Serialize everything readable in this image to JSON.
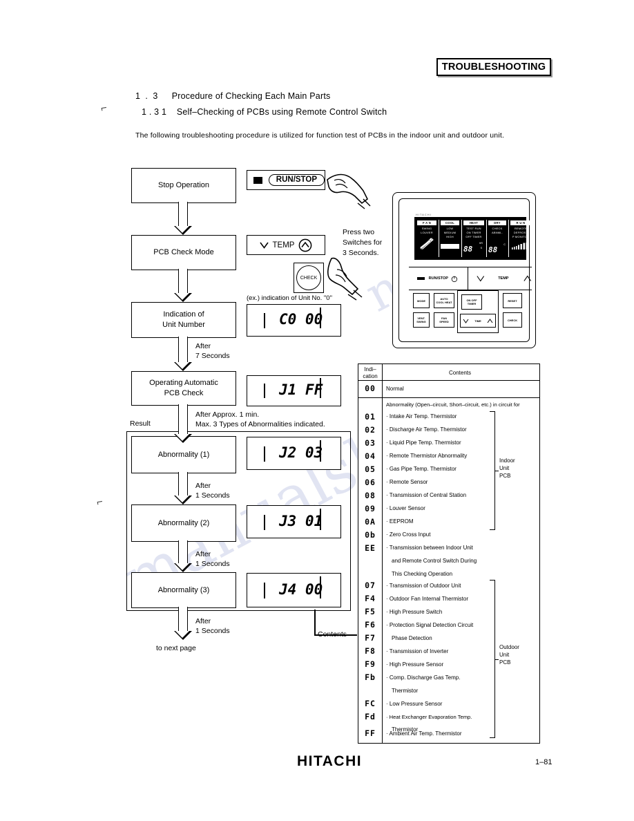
{
  "header": {
    "banner": "TROUBLESHOOTING",
    "section_number": "1 . 3",
    "section_title": "Procedure of Checking Each Main Parts",
    "subsection_number": "1 . 3  1",
    "subsection_title": "Self–Checking of PCBs using Remote Control Switch",
    "intro": "The following troubleshooting procedure is utilized for function test of PCBs in the indoor unit and outdoor unit."
  },
  "flow": {
    "steps": [
      {
        "label": "Stop Operation"
      },
      {
        "label": "PCB Check Mode"
      },
      {
        "label_line1": "Indication of",
        "label_line2": "Unit Number"
      },
      {
        "label_line1": "Operating Automatic",
        "label_line2": "PCB Check"
      },
      {
        "label": "Abnormality (1)"
      },
      {
        "label": "Abnormality (2)"
      },
      {
        "label": "Abnormality (3)"
      }
    ],
    "notes": {
      "after_7_seconds_l1": "After",
      "after_7_seconds_l2": "7 Seconds",
      "after_approx_l1": "After Approx. 1 min.",
      "after_approx_l2": "Max. 3 Types of Abnormalities indicated.",
      "result": "Result",
      "after_1_seconds_l1": "After",
      "after_1_seconds_l2": "1 Seconds",
      "to_next_page": "to next page",
      "contents_link": "Contents"
    }
  },
  "keys": {
    "run_stop": "RUN/STOP",
    "temp": "TEMP",
    "temp_down_icon": "chevron-down-icon",
    "temp_up_icon": "chevron-up-icon",
    "check": "CHECK",
    "press_note_l1": "Press two",
    "press_note_l2": "Switches for",
    "press_note_l3": "3 Seconds.",
    "hand_icon": "pointing-hand-icon"
  },
  "displays": {
    "example_caption": "(ex.) indication of Unit No. \"0\"",
    "unit_number": "C0 00",
    "auto_check": "J1 FF",
    "abnormality_1": "J2 03",
    "abnormality_2": "J3 01",
    "abnormality_3": "J4 00"
  },
  "remote": {
    "brand": "HITACHI",
    "lcd": {
      "cells": [
        {
          "tag": "F A N",
          "labels": [
            "SWING",
            "LOUVER"
          ],
          "icon": "louver-blades-icon"
        },
        {
          "tag": "COOL",
          "labels": [
            "LOW",
            "MEDIUM",
            "HIGH"
          ],
          "bar": "fan-speed-bar-icon"
        },
        {
          "tag": "HEAT",
          "labels": [
            "TEST RUN",
            "ON TIMER",
            "OFF TIMER"
          ],
          "value": "88",
          "unit_top": "HR",
          "unit_bottom": "S"
        },
        {
          "tag": "DRY",
          "labels": [
            "CHECK",
            "ABNML."
          ],
          "value": "88",
          "unit_top": "C"
        },
        {
          "tag": "R U N",
          "labels": [
            "REMOTE",
            "DEFROST",
            "P MONITOR"
          ],
          "bar": "signal-bars-icon"
        }
      ]
    },
    "control_row": {
      "run_stop": "RUN/STOP",
      "power_icon": "power-icon",
      "temp": "TEMP",
      "down_icon": "chevron-down-icon",
      "up_icon": "chevron-up-icon"
    },
    "buttons": [
      {
        "id": "mode",
        "label": "MODE"
      },
      {
        "id": "auto-louver",
        "label": "AUTO\nCOOL HEAT"
      },
      {
        "id": "timer",
        "label": "ON OFF\nTIMER"
      },
      {
        "id": "reset",
        "label": "RESET"
      },
      {
        "id": "vent-swing",
        "label": "VENT.\nSWING"
      },
      {
        "id": "fan-speed",
        "label": "FAN\nSPEED"
      },
      {
        "id": "time",
        "label": "TIME"
      },
      {
        "id": "check",
        "label": "CHECK"
      }
    ]
  },
  "table": {
    "header_indication_l1": "Indi–",
    "header_indication_l2": "cation",
    "header_contents": "Contents",
    "normal": {
      "code": "00",
      "text": "Normal"
    },
    "abnormality_heading": "Abnormality (Open–circuit, Short–circuit, etc.) in circuit for",
    "indoor_group_label_l1": "Indoor",
    "indoor_group_label_l2": "Unit",
    "indoor_group_label_l3": "PCB",
    "outdoor_group_label_l1": "Outdoor",
    "outdoor_group_label_l2": "Unit",
    "outdoor_group_label_l3": "PCB",
    "indoor_rows": [
      {
        "code": "01",
        "text": "· Intake Air Temp. Thermistor"
      },
      {
        "code": "02",
        "text": "· Discharge Air Temp. Thermistor"
      },
      {
        "code": "03",
        "text": "· Liquid Pipe Temp. Thermistor"
      },
      {
        "code": "04",
        "text": "· Remote Thermistor Abnormality"
      },
      {
        "code": "05",
        "text": "· Gas Pipe Temp. Thermistor"
      },
      {
        "code": "06",
        "text": "· Remote Sensor"
      },
      {
        "code": "08",
        "text": "· Transmission of Central Station"
      },
      {
        "code": "09",
        "text": "· Louver Sensor"
      },
      {
        "code": "0A",
        "text": "· EEPROM"
      }
    ],
    "extra_rows": [
      {
        "code": "0b",
        "text": "· Zero Cross Input"
      },
      {
        "code": "EE",
        "text": "· Transmission between Indoor Unit"
      },
      {
        "code": "",
        "text": "and Remote Control Switch During"
      },
      {
        "code": "",
        "text": "This Checking Operation"
      }
    ],
    "outdoor_rows": [
      {
        "code": "07",
        "text": "· Transmission of Outdoor Unit"
      },
      {
        "code": "F4",
        "text": "· Outdoor Fan Internal Thermistor"
      },
      {
        "code": "F5",
        "text": "· High Pressure Switch"
      },
      {
        "code": "F6",
        "text": "· Protection Signal Detection Circuit"
      },
      {
        "code": "F7",
        "text": "Phase Detection"
      },
      {
        "code": "F8",
        "text": "· Transmission of Inverter"
      },
      {
        "code": "F9",
        "text": "· High Pressure Sensor"
      },
      {
        "code": "Fb",
        "text": "· Comp. Discharge Gas Temp."
      },
      {
        "code": "",
        "text": "Thermistor"
      },
      {
        "code": "FC",
        "text": "· Low Pressure Sensor"
      },
      {
        "code": "Fd",
        "text": "· Heat Exchanger Evaporation Temp."
      },
      {
        "code": "",
        "text": "Thermistor"
      },
      {
        "code": "FF",
        "text": "· Ambient Air Temp. Thermistor"
      }
    ]
  },
  "footer": {
    "brand": "HITACHI",
    "page_number": "1–81"
  },
  "watermark": {
    "text1": "manualshi",
    "text2": "ne.com"
  }
}
